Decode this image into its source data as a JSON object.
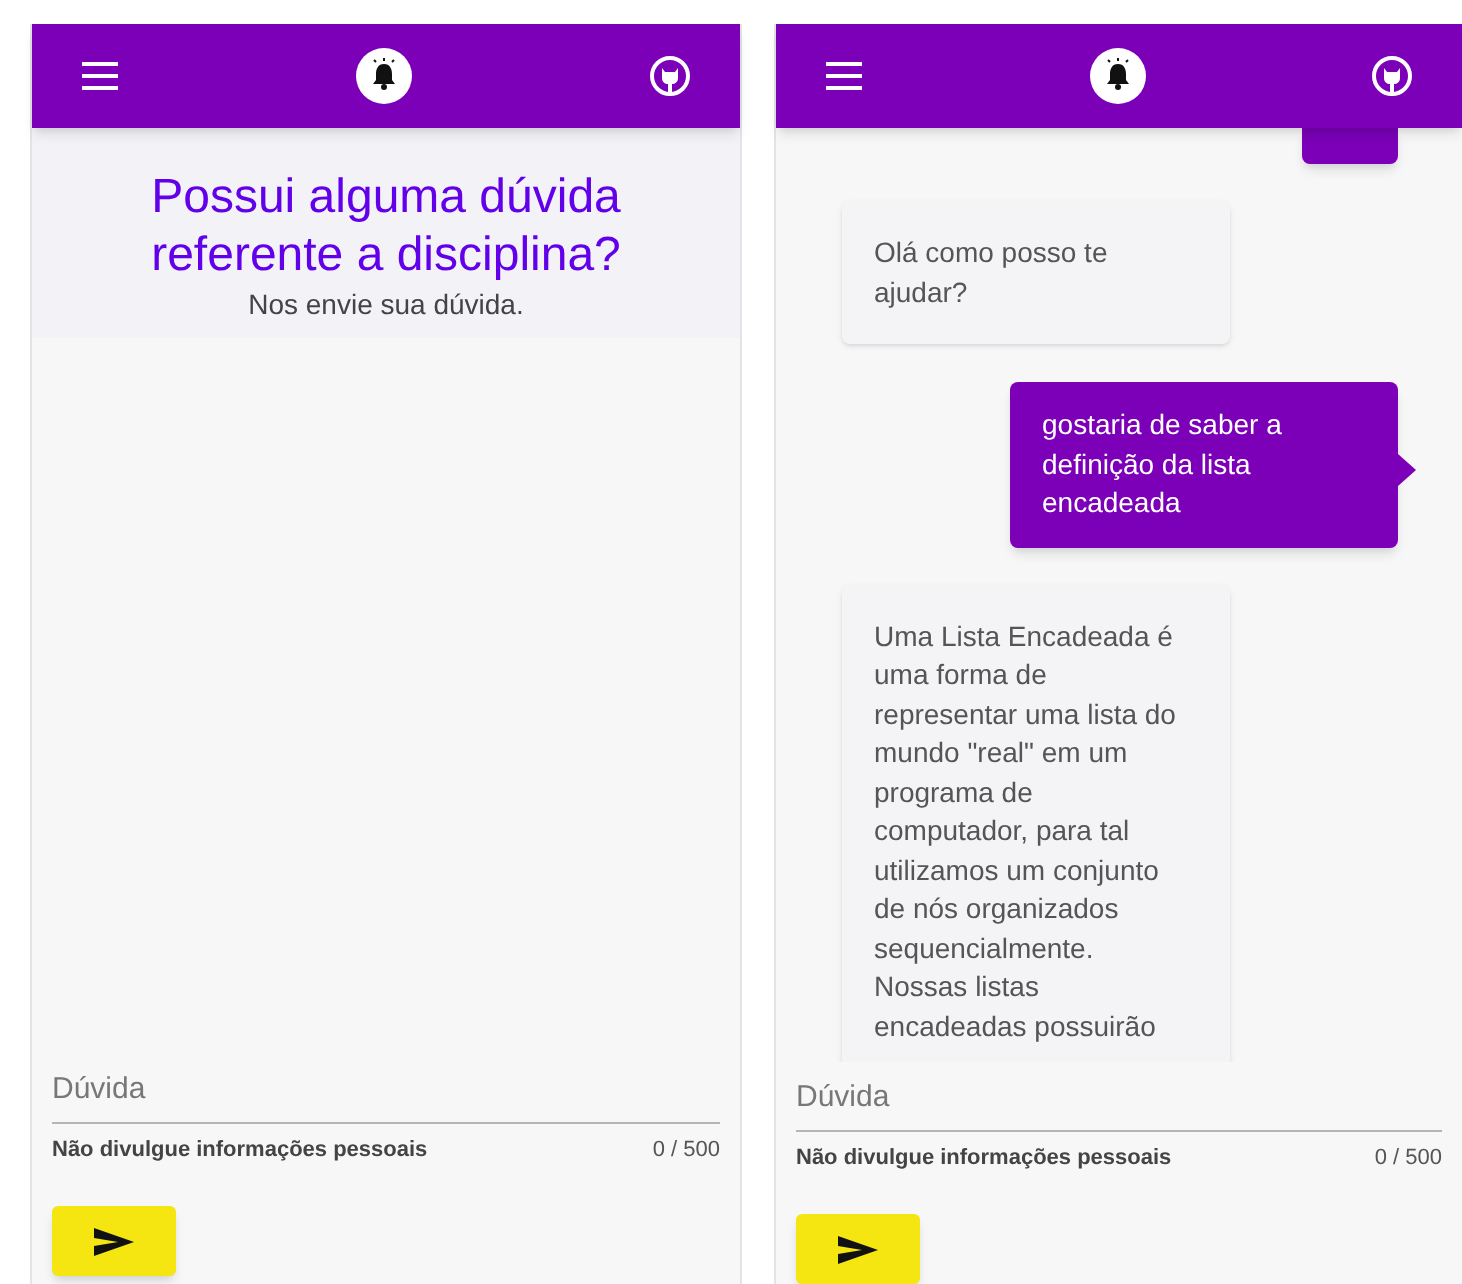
{
  "screens": [
    {
      "kind": "form",
      "heading": "Possui alguma dúvida referente a disciplina?",
      "subheading": "Nos envie sua dúvida.",
      "field": {
        "placeholder": "Dúvida",
        "hint": "Não divulgue informações pessoais",
        "counter": "0 / 500"
      }
    },
    {
      "kind": "chat",
      "messages": [
        {
          "kind": "user"
        },
        {
          "kind": "bot",
          "text": "Olá como posso te ajudar?"
        },
        {
          "kind": "user",
          "text": "gostaria de saber a definição da lista encadeada"
        },
        {
          "kind": "bot",
          "text": "Uma Lista Encadeada é uma forma de representar uma lista do mundo \"real\" em um programa de computador, para tal utilizamos um conjunto de nós organizados sequencialmente. Nossas listas encadeadas possuirão"
        }
      ],
      "field": {
        "placeholder": "Dúvida",
        "hint": "Não divulgue informações pessoais",
        "counter": "0 / 500"
      }
    }
  ]
}
